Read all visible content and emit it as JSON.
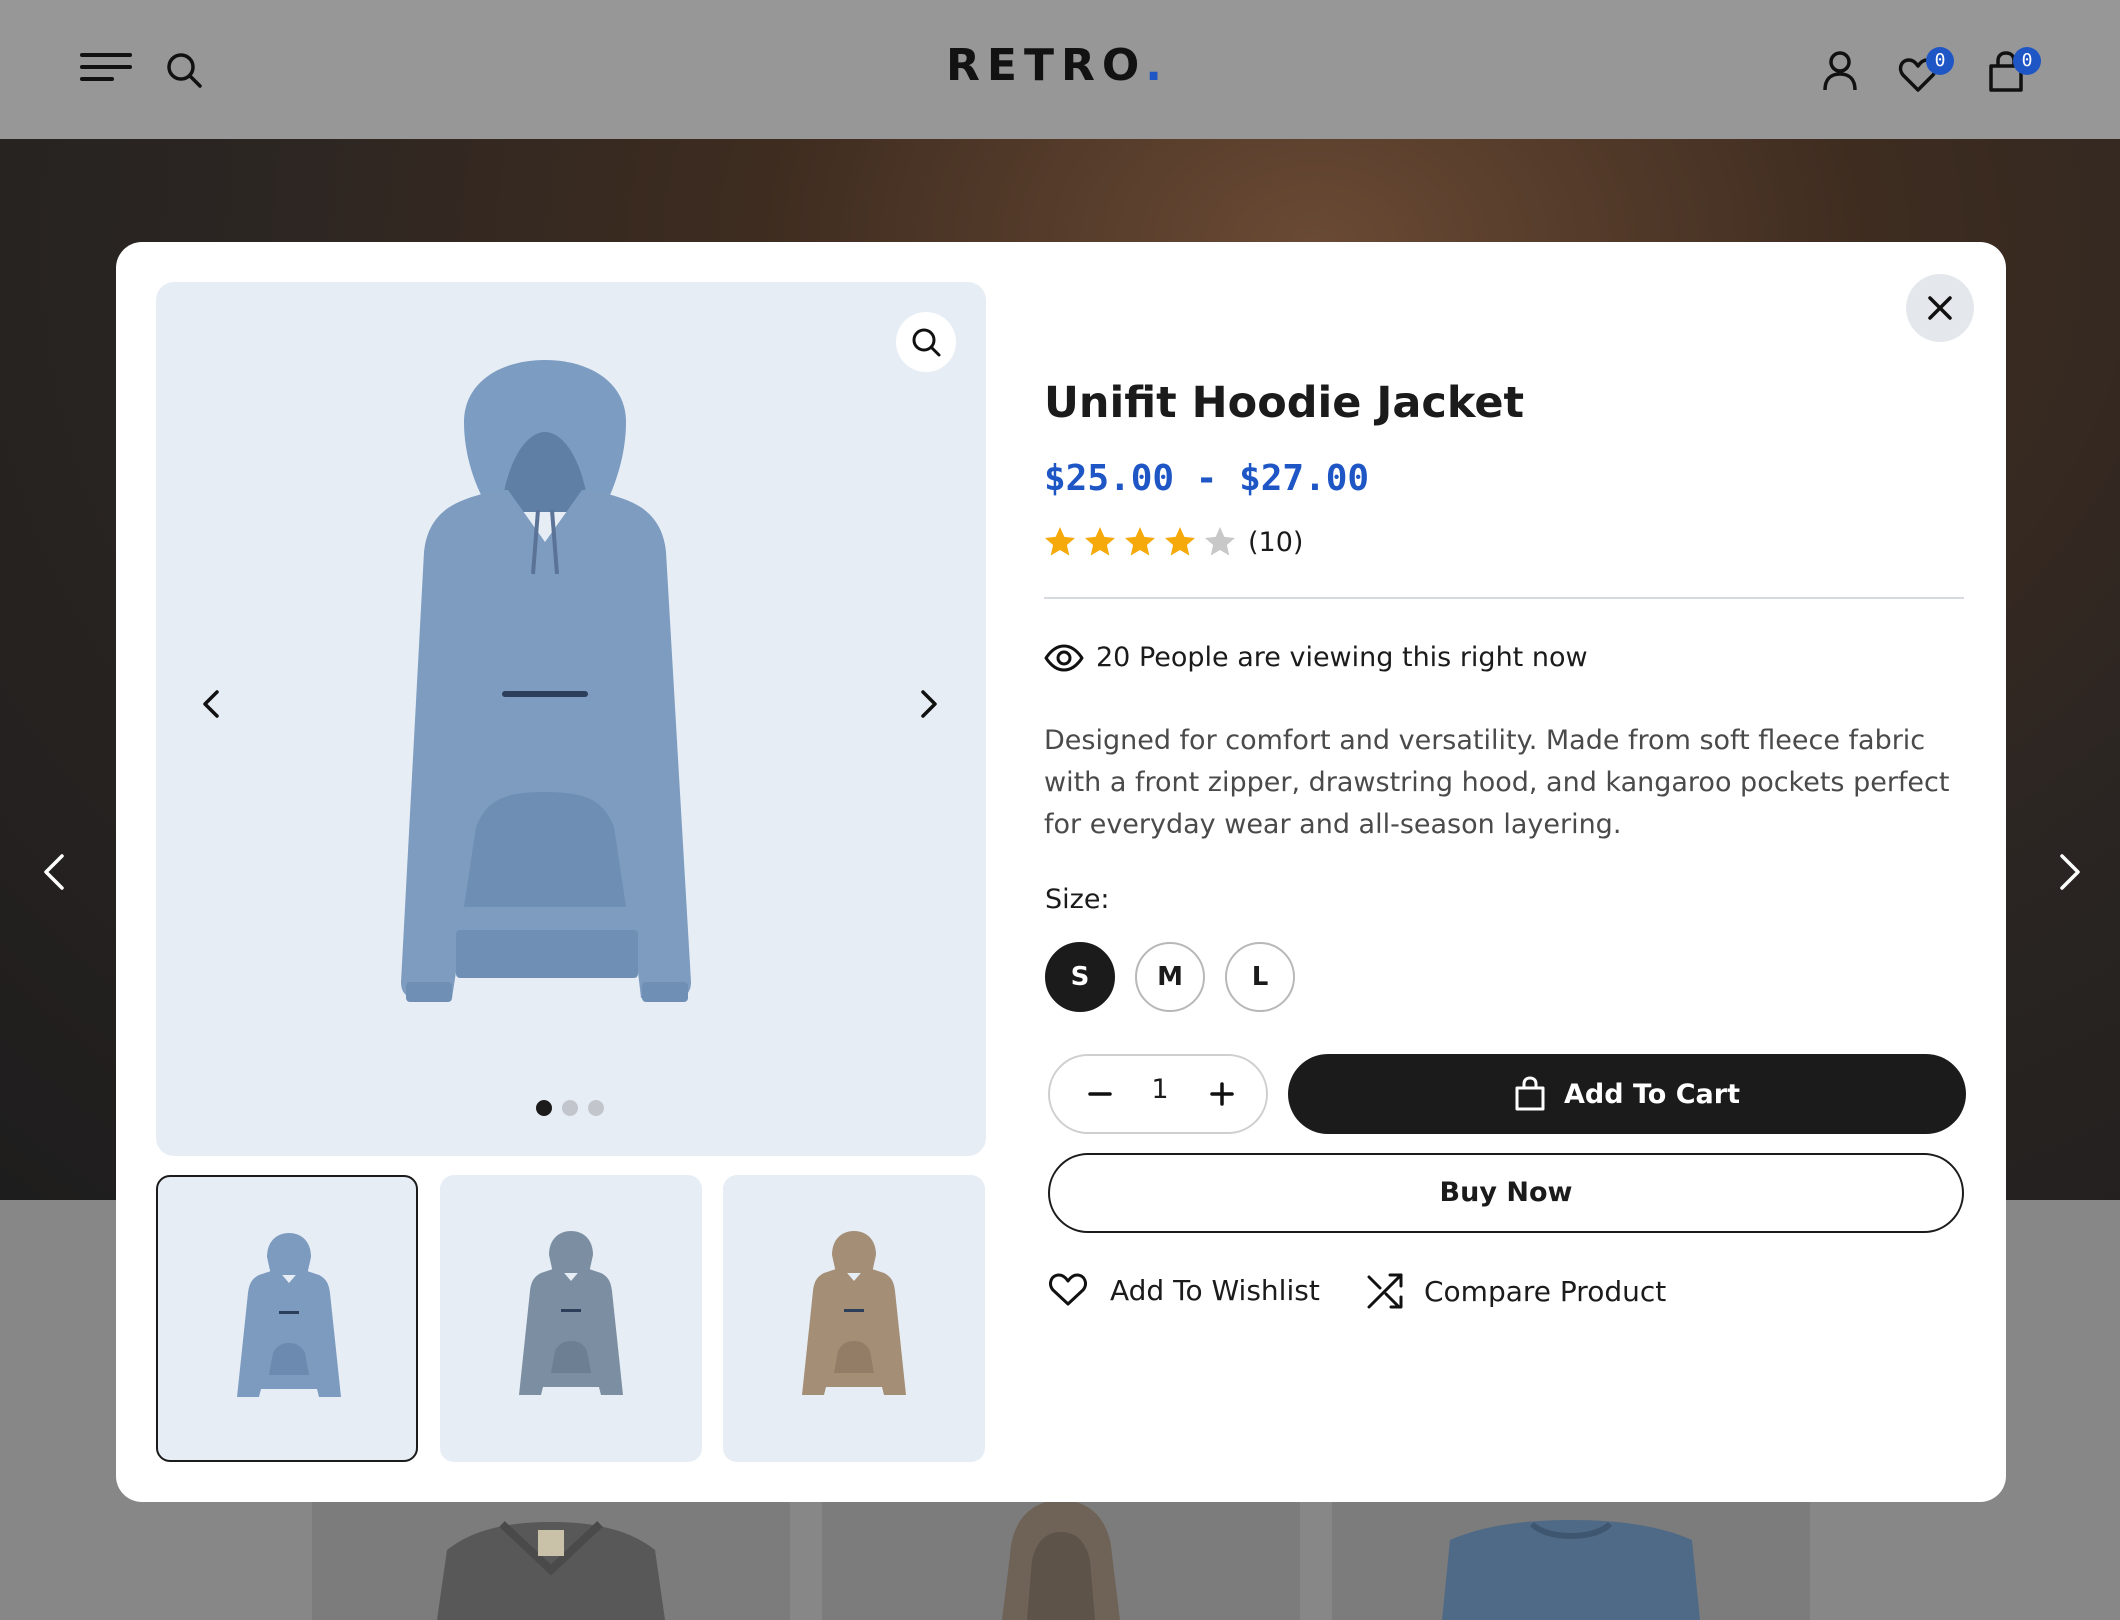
{
  "colors": {
    "accent": "#1f56c6",
    "dark": "#1b1b1b",
    "star": "#f6a90b",
    "star_empty": "#c8c8c8",
    "image_bg": "#e6edf5"
  },
  "header": {
    "logo_text": "RETRO",
    "logo_dot": ".",
    "wishlist_count": "0",
    "cart_count": "0",
    "icons": [
      "menu-icon",
      "search-icon",
      "user-icon",
      "heart-icon",
      "shopping-bag-icon"
    ]
  },
  "modal": {
    "product_title": "Unifit Hoodie Jacket",
    "price_range": "$25.00 - $27.00",
    "rating": {
      "value": 4,
      "max": 5,
      "count_label": "(10)"
    },
    "viewing_text": "20 People are viewing this right now",
    "description": "Designed for comfort and versatility. Made from soft fleece fabric with a front zipper, drawstring hood, and kangaroo pockets perfect for everyday wear and all-season layering.",
    "size_label": "Size:",
    "sizes": [
      "S",
      "M",
      "L"
    ],
    "selected_size": "S",
    "quantity": "1",
    "add_to_cart_label": "Add To Cart",
    "buy_now_label": "Buy Now",
    "wishlist_label": "Add To Wishlist",
    "compare_label": "Compare Product",
    "gallery": {
      "slide_count": 3,
      "active_slide": 1,
      "thumbnails": [
        {
          "color": "#7d9bbf",
          "active": true
        },
        {
          "color": "#7c8fa2",
          "active": false
        },
        {
          "color": "#a48e76",
          "active": false
        }
      ]
    }
  }
}
